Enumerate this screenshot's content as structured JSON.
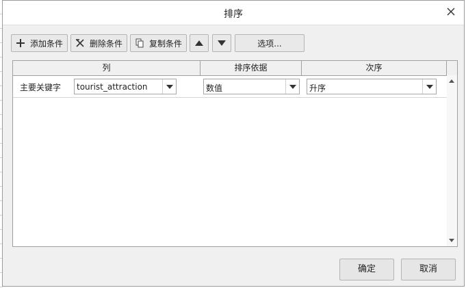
{
  "dialog": {
    "title": "排序"
  },
  "toolbar": {
    "add_label": "添加条件",
    "delete_label": "删除条件",
    "copy_label": "复制条件",
    "options_label": "选项..."
  },
  "grid": {
    "headers": [
      "列",
      "排序依据",
      "次序"
    ],
    "rows": [
      {
        "label": "主要关键字",
        "column": "tourist_attraction",
        "sort_on": "数值",
        "order": "升序"
      }
    ]
  },
  "footer": {
    "ok_label": "确定",
    "cancel_label": "取消"
  },
  "icons": {
    "close": "close-icon",
    "add": "plus-icon",
    "delete": "delete-icon",
    "copy": "copy-icon",
    "up": "arrow-up-icon",
    "down": "arrow-down-icon"
  }
}
